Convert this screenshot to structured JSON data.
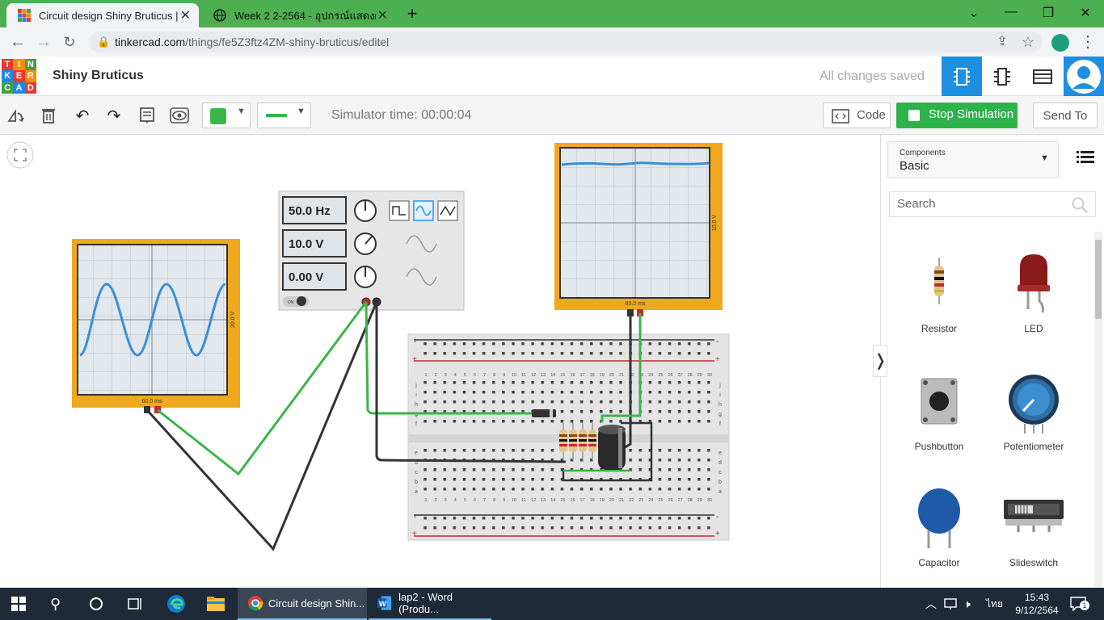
{
  "browser": {
    "tabs": [
      {
        "title": "Circuit design Shiny Bruticus | Tin",
        "active": true
      },
      {
        "title": "Week 2 2-2564 - อุปกรณ์แสดงผลอิเ",
        "active": false
      }
    ],
    "url_host": "tinkercad.com",
    "url_path": "/things/fe5Z3ftz4ZM-shiny-bruticus/editel"
  },
  "header": {
    "logo_letters": [
      "T",
      "I",
      "N",
      "K",
      "E",
      "R",
      "C",
      "A",
      "D"
    ],
    "design_name": "Shiny Bruticus",
    "save_status": "All changes saved"
  },
  "toolbar": {
    "simulator_time": "Simulator time: 00:00:04",
    "code_label": "Code",
    "stop_label": "Stop Simulation",
    "send_label": "Send To",
    "color_value": "#3ab54a"
  },
  "function_generator": {
    "frequency": "50.0 Hz",
    "amplitude": "10.0 V",
    "offset": "0.00 V",
    "switch_label": "ON"
  },
  "oscilloscope_left": {
    "time_label": "60.0 ms",
    "volt_label": "20.0 V"
  },
  "oscilloscope_right": {
    "time_label": "60.0 ms",
    "volt_label": "10.0 V"
  },
  "breadboard": {
    "row_labels_top": [
      "j",
      "i",
      "h",
      "g",
      "f"
    ],
    "row_labels_bottom": [
      "e",
      "d",
      "c",
      "b",
      "a"
    ],
    "columns": [
      "1",
      "2",
      "3",
      "4",
      "5",
      "6",
      "7",
      "8",
      "9",
      "10",
      "11",
      "12",
      "13",
      "14",
      "15",
      "16",
      "17",
      "18",
      "19",
      "20",
      "21",
      "22",
      "23",
      "24",
      "25",
      "26",
      "27",
      "28",
      "29",
      "30"
    ]
  },
  "panel": {
    "components_label": "Components",
    "components_value": "Basic",
    "search_placeholder": "Search",
    "items": [
      {
        "name": "Resistor"
      },
      {
        "name": "LED"
      },
      {
        "name": "Pushbutton"
      },
      {
        "name": "Potentiometer"
      },
      {
        "name": "Capacitor"
      },
      {
        "name": "Slideswitch"
      }
    ]
  },
  "taskbar": {
    "chrome_item": "Circuit design Shin...",
    "word_item": "lap2 - Word (Produ...",
    "language": "ไทย",
    "time": "15:43",
    "date": "9/12/2564",
    "notification_count": "1"
  },
  "colors": {
    "tab_strip": "#4caf50",
    "tinkercad_blue": "#1e8fe1",
    "scope_frame": "#f0a81e",
    "wire_green": "#3ab54a",
    "wire_black": "#333333",
    "stop_green": "#2eb34b"
  }
}
